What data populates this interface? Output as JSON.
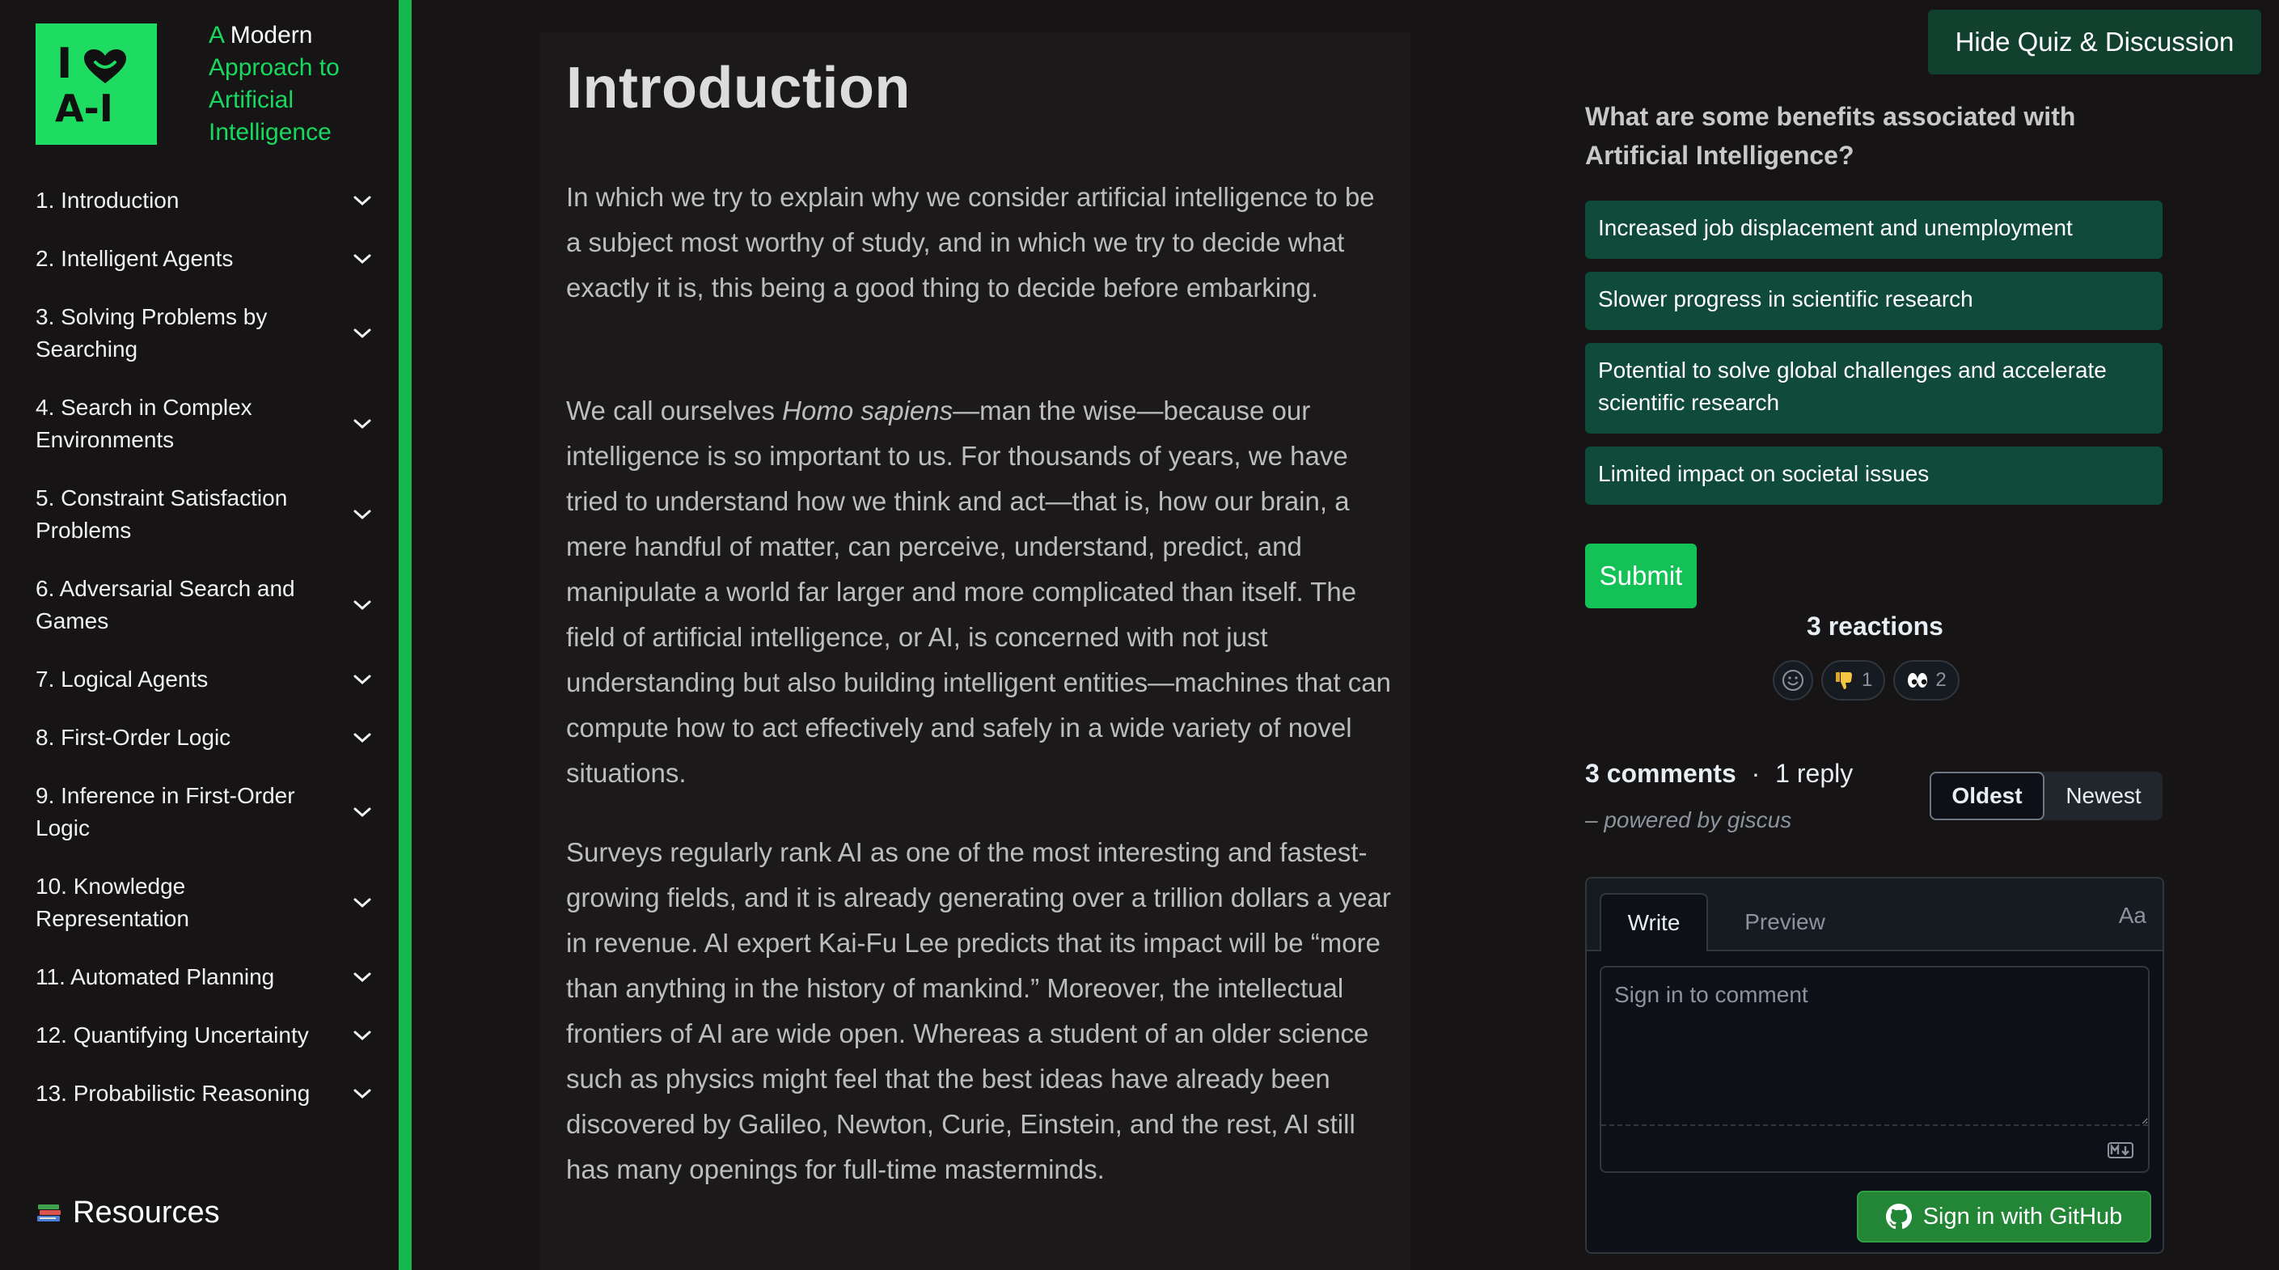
{
  "brand": {
    "logo_line1": "I",
    "logo_line2": "A-I",
    "title_a": "A",
    "title_modern": "Modern",
    "title_rest": "Approach to Artificial Intelligence",
    "accent_color": "#1ddc61"
  },
  "sidebar": {
    "items": [
      {
        "label": "1. Introduction"
      },
      {
        "label": "2. Intelligent Agents"
      },
      {
        "label": "3. Solving Problems by Searching"
      },
      {
        "label": "4. Search in Complex Environments"
      },
      {
        "label": "5. Constraint Satisfaction Problems"
      },
      {
        "label": "6. Adversarial Search and Games"
      },
      {
        "label": "7. Logical Agents"
      },
      {
        "label": "8. First-Order Logic"
      },
      {
        "label": "9. Inference in First-Order Logic"
      },
      {
        "label": "10. Knowledge Representation"
      },
      {
        "label": "11. Automated Planning"
      },
      {
        "label": "12. Quantifying Uncertainty"
      },
      {
        "label": "13. Probabilistic Reasoning"
      }
    ],
    "resources_icon": "books-icon",
    "resources_label": "Resources"
  },
  "article": {
    "title": "Introduction",
    "p1": "In which we try to explain why we consider artificial intelligence to be a subject most worthy of study, and in which we try to decide what exactly it is, this being a good thing to decide before embarking.",
    "p2_before": "We call ourselves ",
    "p2_em": "Homo sapiens",
    "p2_after": "—man the wise—because our intelligence is so important to us. For thousands of years, we have tried to understand how we think and act—that is, how our brain, a mere handful of matter, can perceive, understand, predict, and manipulate a world far larger and more complicated than itself. The field of artificial intelligence, or AI, is concerned with not just understanding but also building intelligent entities—machines that can compute how to act effectively and safely in a wide variety of novel situations.",
    "p3": "Surveys regularly rank AI as one of the most interesting and fastest-growing fields, and it is already generating over a trillion dollars a year in revenue. AI expert Kai-Fu Lee predicts that its impact will be “more than anything in the history of mankind.” Moreover, the intellectual frontiers of AI are wide open. Whereas a student of an older science such as physics might feel that the best ideas have already been discovered by Galileo, Newton, Curie, Einstein, and the rest, AI still has many openings for full-time masterminds."
  },
  "quiz": {
    "hide_label": "Hide Quiz & Discussion",
    "question": "What are some benefits associated with Artificial Intelligence?",
    "options": [
      {
        "label": "Increased job displacement and unemployment"
      },
      {
        "label": "Slower progress in scientific research"
      },
      {
        "label": "Potential to solve global challenges and accelerate scientific research"
      },
      {
        "label": "Limited impact on societal issues"
      }
    ],
    "submit_label": "Submit"
  },
  "giscus": {
    "reactions_title": "3 reactions",
    "reactions": [
      {
        "icon": "thumbs-down-icon",
        "count": "1"
      },
      {
        "icon": "eyes-icon",
        "count": "2"
      }
    ],
    "comments_count": "3 comments",
    "separator": "·",
    "replies_count": "1 reply",
    "powered_by": "– powered by giscus",
    "sort_oldest": "Oldest",
    "sort_newest": "Newest",
    "tab_write": "Write",
    "tab_preview": "Preview",
    "format_toggle": "Aa",
    "comment_placeholder": "Sign in to comment",
    "signin_label": "Sign in with GitHub"
  }
}
